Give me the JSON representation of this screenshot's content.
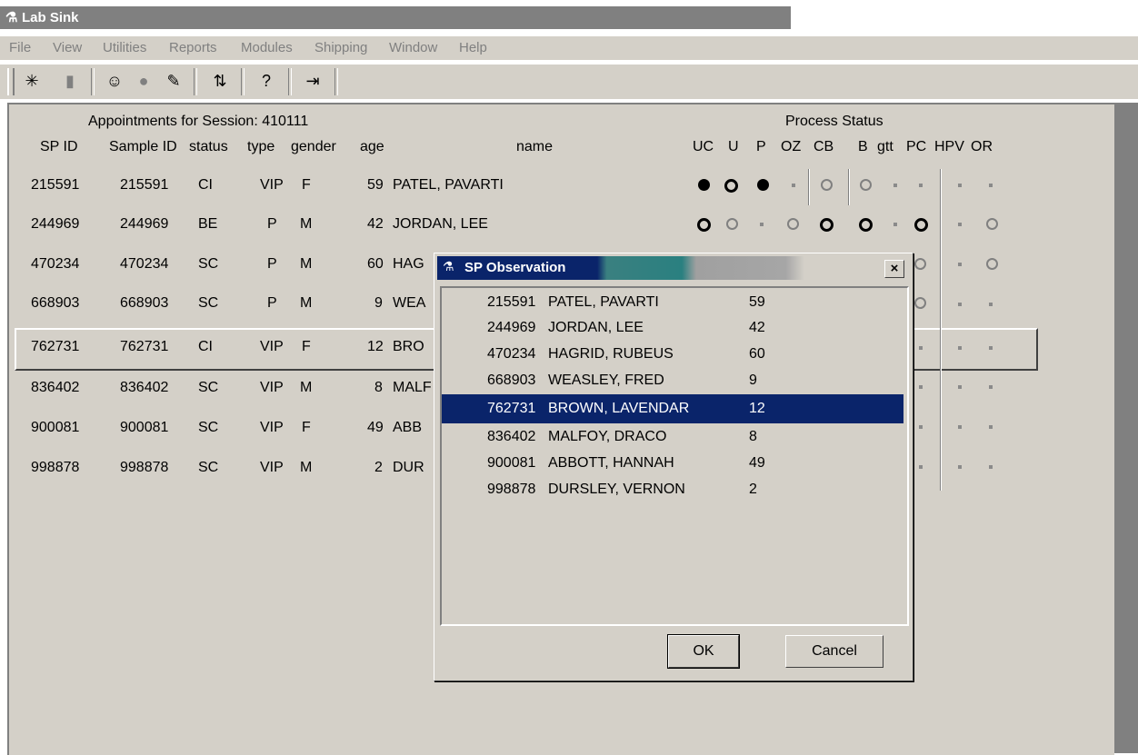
{
  "window": {
    "title": "Lab Sink"
  },
  "menu": [
    "File",
    "View",
    "Utilities",
    "Reports",
    "Modules",
    "Shipping",
    "Window",
    "Help"
  ],
  "toolbar_icons": [
    "new-icon",
    "open-icon",
    "users-icon",
    "stop-icon",
    "inspect-icon",
    "sort-icon",
    "help-icon",
    "exit-icon"
  ],
  "session": {
    "header": "Appointments for Session: 410111",
    "process_status": "Process Status"
  },
  "columns": {
    "spid": "SP ID",
    "sample": "Sample ID",
    "status": "status",
    "type": "type",
    "gender": "gender",
    "age": "age",
    "name": "name"
  },
  "process_columns": [
    "UC",
    "U",
    "P",
    "OZ",
    "CB",
    "B",
    "gtt",
    "PC",
    "HPV",
    "OR"
  ],
  "rows": [
    {
      "spid": "215591",
      "sample": "215591",
      "status": "CI",
      "type": "VIP",
      "gender": "F",
      "age": "59",
      "name": "PATEL, PAVARTI"
    },
    {
      "spid": "244969",
      "sample": "244969",
      "status": "BE",
      "type": "P",
      "gender": "M",
      "age": "42",
      "name": "JORDAN, LEE"
    },
    {
      "spid": "470234",
      "sample": "470234",
      "status": "SC",
      "type": "P",
      "gender": "M",
      "age": "60",
      "name": "HAG"
    },
    {
      "spid": "668903",
      "sample": "668903",
      "status": "SC",
      "type": "P",
      "gender": "M",
      "age": "9",
      "name": "WEA"
    },
    {
      "spid": "762731",
      "sample": "762731",
      "status": "CI",
      "type": "VIP",
      "gender": "F",
      "age": "12",
      "name": "BRO"
    },
    {
      "spid": "836402",
      "sample": "836402",
      "status": "SC",
      "type": "VIP",
      "gender": "M",
      "age": "8",
      "name": "MALF"
    },
    {
      "spid": "900081",
      "sample": "900081",
      "status": "SC",
      "type": "VIP",
      "gender": "F",
      "age": "49",
      "name": "ABB"
    },
    {
      "spid": "998878",
      "sample": "998878",
      "status": "SC",
      "type": "VIP",
      "gender": "M",
      "age": "2",
      "name": "DUR"
    }
  ],
  "dialog": {
    "title": "SP Observation",
    "close_label": "×",
    "items": [
      {
        "id": "215591",
        "name": "PATEL, PAVARTI",
        "age": "59"
      },
      {
        "id": "244969",
        "name": "JORDAN, LEE",
        "age": "42"
      },
      {
        "id": "470234",
        "name": "HAGRID, RUBEUS",
        "age": "60"
      },
      {
        "id": "668903",
        "name": "WEASLEY, FRED",
        "age": "9"
      },
      {
        "id": "762731",
        "name": "BROWN, LAVENDAR",
        "age": "12"
      },
      {
        "id": "836402",
        "name": "MALFOY, DRACO",
        "age": "8"
      },
      {
        "id": "900081",
        "name": "ABBOTT, HANNAH",
        "age": "49"
      },
      {
        "id": "998878",
        "name": "DURSLEY, VERNON",
        "age": "2"
      }
    ],
    "selected_index": 4,
    "ok_label": "OK",
    "cancel_label": "Cancel"
  },
  "colors": {
    "face": "#d4d0c8",
    "selection": "#0a246a",
    "title_inactive": "#808080"
  }
}
